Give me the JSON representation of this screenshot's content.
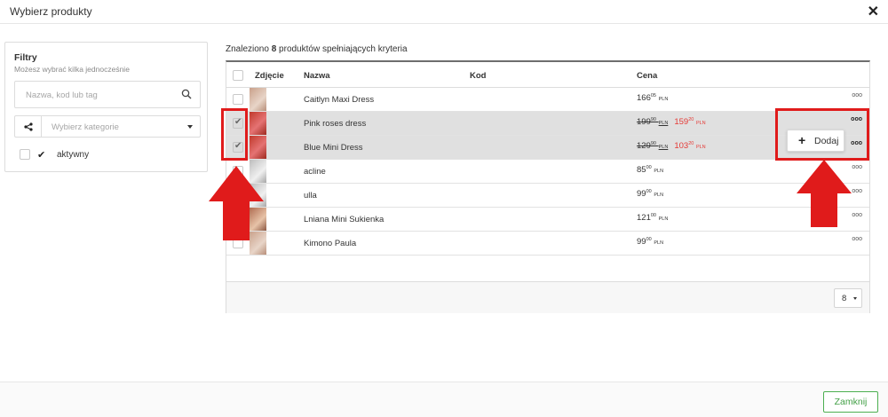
{
  "modal": {
    "title": "Wybierz produkty"
  },
  "filters": {
    "title": "Filtry",
    "subtitle": "Możesz wybrać kilka jednocześnie",
    "search_placeholder": "Nazwa, kod lub tag",
    "category_placeholder": "Wybierz kategorie",
    "active_label": "aktywny"
  },
  "results": {
    "prefix": "Znaleziono",
    "count": "8",
    "suffix": "produktów spełniających kryteria"
  },
  "table": {
    "headers": {
      "photo": "Zdjęcie",
      "name": "Nazwa",
      "code": "Kod",
      "price": "Cena"
    },
    "rows": [
      {
        "name": "Caitlyn Maxi Dress",
        "price_int": "166",
        "price_dec": "05",
        "currency": "PLN",
        "selected": false
      },
      {
        "name": "Pink roses dress",
        "old_price_int": "199",
        "old_price_dec": "90",
        "price_int": "159",
        "price_dec": "20",
        "currency": "PLN",
        "selected": true
      },
      {
        "name": "Blue Mini Dress",
        "old_price_int": "129",
        "old_price_dec": "90",
        "price_int": "103",
        "price_dec": "20",
        "currency": "PLN",
        "selected": true
      },
      {
        "name": "acline",
        "price_int": "85",
        "price_dec": "00",
        "currency": "PLN",
        "selected": false
      },
      {
        "name": "ulla",
        "price_int": "99",
        "price_dec": "00",
        "currency": "PLN",
        "selected": false
      },
      {
        "name": "Lniana Mini Sukienka",
        "price_int": "121",
        "price_dec": "00",
        "currency": "PLN",
        "selected": false
      },
      {
        "name": "Kimono Paula",
        "price_int": "99",
        "price_dec": "00",
        "currency": "PLN",
        "selected": false
      }
    ],
    "more_icon": "ooo",
    "per_page": "8"
  },
  "popup": {
    "label": "Dodaj",
    "plus": "+"
  },
  "footer": {
    "close_label": "Zamknij"
  },
  "colors": {
    "highlight": "#e01b1b",
    "sale_price": "#e53935",
    "close_button": "#43a047",
    "selected_row": "#e0e0e0"
  }
}
